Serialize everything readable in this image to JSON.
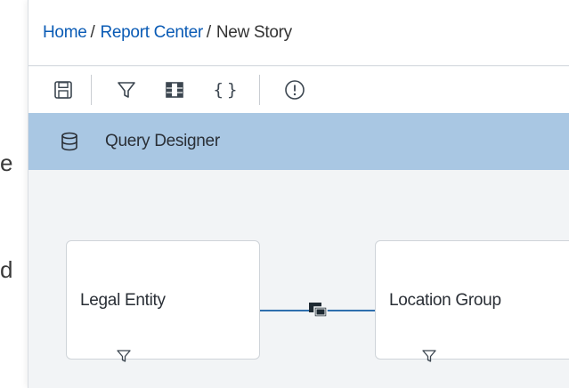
{
  "background_fragments": [
    "e",
    "d"
  ],
  "breadcrumb": {
    "items": [
      {
        "label": "Home",
        "link": true
      },
      {
        "label": "Report Center",
        "link": true
      },
      {
        "label": "New Story",
        "link": false
      }
    ],
    "separator": "/"
  },
  "toolbar": {
    "buttons": [
      {
        "name": "save-icon"
      },
      {
        "name": "filter-icon"
      },
      {
        "name": "columns-icon"
      },
      {
        "name": "braces-icon",
        "text": "{}"
      },
      {
        "name": "warning-icon"
      }
    ]
  },
  "section": {
    "icon": "database-icon",
    "title": "Query Designer"
  },
  "model": {
    "nodes": [
      {
        "label": "Legal Entity"
      },
      {
        "label": "Location Group"
      }
    ],
    "join_icon": "join-icon"
  },
  "colors": {
    "link": "#0a5bb5",
    "header_bg": "#a9c7e3",
    "join_line": "#2f6fae",
    "canvas_bg": "#f2f4f6"
  }
}
